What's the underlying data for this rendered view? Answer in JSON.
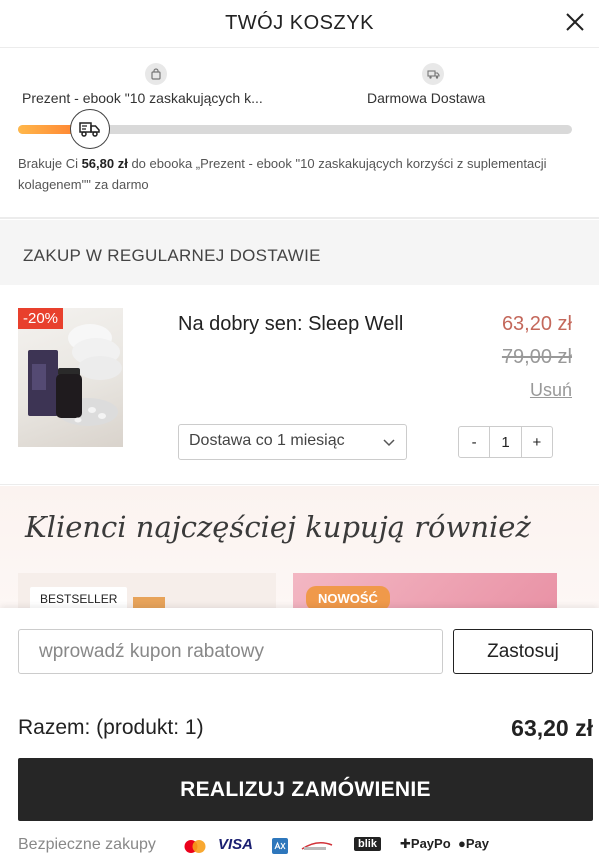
{
  "header": {
    "title": "TWÓJ KOSZYK"
  },
  "progress": {
    "milestone_gift_label": "Prezent - ebook \"10 zaskakujących k...",
    "milestone_shipping_label": "Darmowa Dostawa",
    "fill_fraction": 0.13,
    "message_before": "Brakuje Ci ",
    "message_amount": "56,80 zł",
    "message_after": " do ebooka „Prezent - ebook \"10 zaskakujących korzyści z suplementacji kolagenem\"\" za darmo"
  },
  "section": {
    "title": "ZAKUP W REGULARNEJ DOSTAWIE"
  },
  "product": {
    "discount": "-20%",
    "name": "Na dobry sen: Sleep Well",
    "price_now": "63,20 zł",
    "price_old": "79,00 zł",
    "remove_label": "Usuń",
    "delivery_option": "Dostawa co 1 miesiąc",
    "qty_minus": "-",
    "qty_value": "1",
    "qty_plus": "+"
  },
  "upsell": {
    "title": "Klienci najczęściej kupują również",
    "badge_bestseller": "BESTSELLER",
    "badge_new": "NOWOŚĆ"
  },
  "footer": {
    "coupon_placeholder": "wprowadź kupon rabatowy",
    "apply_label": "Zastosuj",
    "total_label": "Razem: (produkt: 1)",
    "total_value": "63,20 zł",
    "checkout_label": "REALIZUJ ZAMÓWIENIE",
    "secure_label": "Bezpieczne zakupy",
    "payments": [
      "mastercard-icon",
      "VISA",
      "american-express-icon",
      "przelewy24-icon",
      "blik",
      "PayPo",
      "Pay"
    ]
  },
  "colors": {
    "accent_orange": "#ff7a2e",
    "price_red": "#c4685b",
    "badge_red": "#e8402d",
    "button_dark": "#262626"
  }
}
